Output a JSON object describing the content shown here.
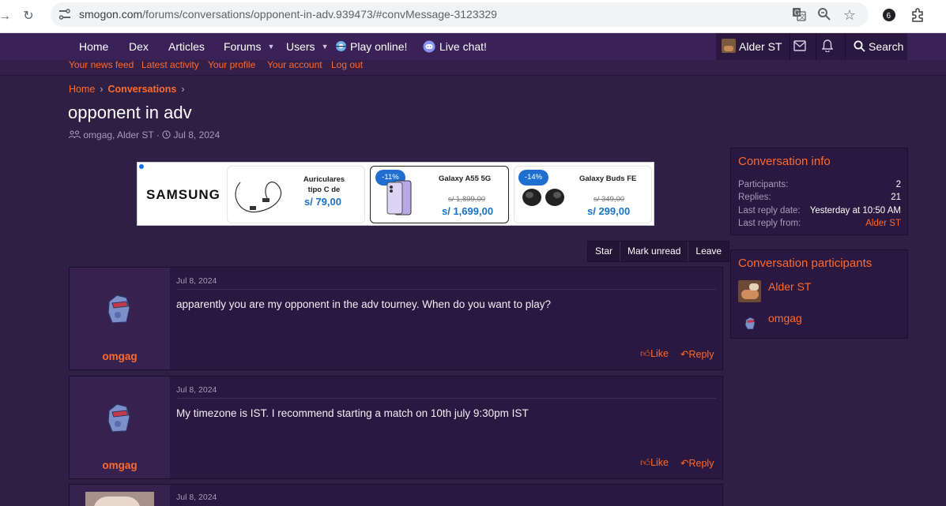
{
  "browser": {
    "url_host": "smogon.com",
    "url_path": "/forums/conversations/opponent-in-adv.939473/#convMessage-3123329"
  },
  "nav": {
    "items": [
      "Home",
      "Dex",
      "Articles",
      "Forums",
      "Users",
      "Play online!",
      "Live chat!"
    ],
    "user": "Alder ST",
    "search": "Search"
  },
  "subnav": [
    "Your news feed",
    "Latest activity",
    "Your profile",
    "Your account",
    "Log out"
  ],
  "breadcrumb": {
    "home": "Home",
    "current": "Conversations"
  },
  "title": "opponent in adv",
  "meta": {
    "participants": "omgag, Alder ST",
    "separator": "·",
    "date": "Jul 8, 2024"
  },
  "ad": {
    "brand": "SAMSUNG",
    "p1": {
      "name1": "Auriculares",
      "name2": "tipo C de",
      "price": "s/ 79,00"
    },
    "p2": {
      "discount": "-11%",
      "name": "Galaxy A55 5G",
      "old": "s/ 1,899,00",
      "price": "s/ 1,699,00"
    },
    "p3": {
      "discount": "-14%",
      "name": "Galaxy Buds FE",
      "old": "s/ 349,00",
      "price": "s/ 299,00"
    }
  },
  "actions": [
    "Star",
    "Mark unread",
    "Leave"
  ],
  "messages": [
    {
      "user": "omgag",
      "date": "Jul 8, 2024",
      "text": "apparently you are my opponent in the adv tourney. When do you want to play?",
      "like": "Like",
      "reply": "Reply"
    },
    {
      "user": "omgag",
      "date": "Jul 8, 2024",
      "text": "My timezone is IST. I recommend starting a match on 10th july 9:30pm IST",
      "like": "Like",
      "reply": "Reply"
    },
    {
      "user": "",
      "date": "Jul 8, 2024",
      "text": "",
      "like": "",
      "reply": ""
    }
  ],
  "info": {
    "title": "Conversation info",
    "participants_label": "Participants:",
    "participants": "2",
    "replies_label": "Replies:",
    "replies": "21",
    "last_date_label": "Last reply date:",
    "last_date": "Yesterday at 10:50 AM",
    "last_from_label": "Last reply from:",
    "last_from": "Alder ST"
  },
  "participants_block": {
    "title": "Conversation participants",
    "list": [
      "Alder ST",
      "omgag"
    ]
  },
  "colors": {
    "accent": "#ff6a2b",
    "bg": "#2f1f45",
    "nav": "#3a2158"
  }
}
